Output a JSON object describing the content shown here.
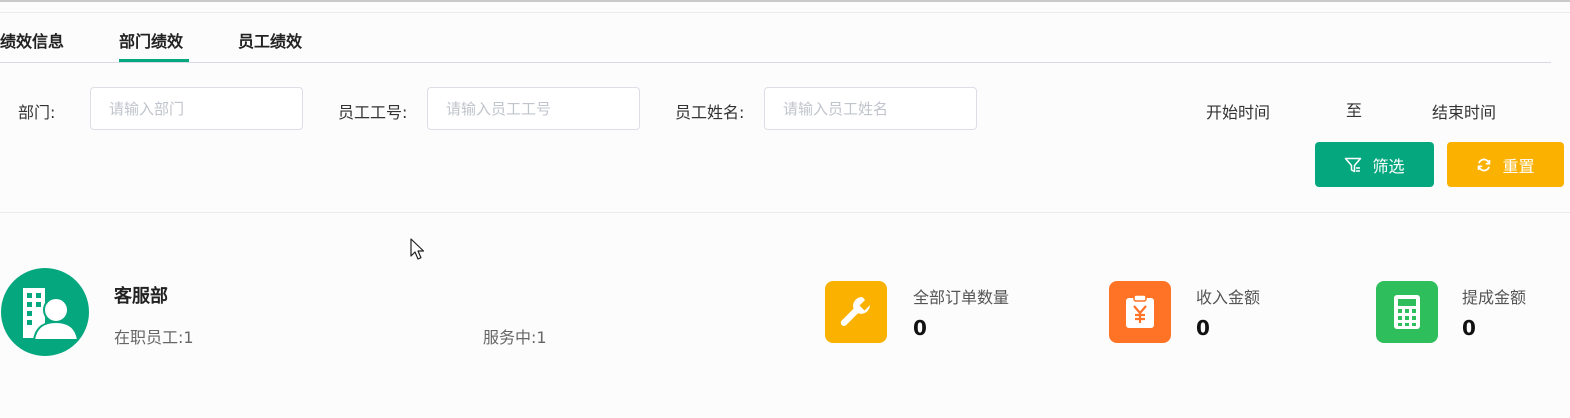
{
  "tabs": [
    {
      "label": "绩效信息",
      "active": false
    },
    {
      "label": "部门绩效",
      "active": true
    },
    {
      "label": "员工绩效",
      "active": false
    }
  ],
  "filters": {
    "department": {
      "label": "部门:",
      "placeholder": "请输入部门"
    },
    "employee_id": {
      "label": "员工工号:",
      "placeholder": "请输入员工工号"
    },
    "employee_name": {
      "label": "员工姓名:",
      "placeholder": "请输入员工姓名"
    },
    "start_time": "开始时间",
    "to": "至",
    "end_time": "结束时间",
    "filter_button": "筛选",
    "reset_button": "重置"
  },
  "department": {
    "name": "客服部",
    "employees": "在职员工:1",
    "in_service": "服务中:1"
  },
  "stats": [
    {
      "label": "全部订单数量",
      "value": "0",
      "icon": "wrench-icon",
      "color": "#fbb100"
    },
    {
      "label": "收入金额",
      "value": "0",
      "icon": "yen-clipboard-icon",
      "color": "#fe7326"
    },
    {
      "label": "提成金额",
      "value": "0",
      "icon": "calculator-icon",
      "color": "#2fbe5c"
    }
  ],
  "colors": {
    "accent": "#05a77e",
    "warning": "#fbb100"
  }
}
